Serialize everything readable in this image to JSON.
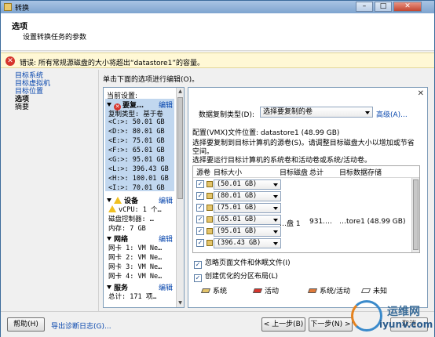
{
  "window": {
    "title": "转换"
  },
  "header": {
    "title": "选项",
    "subtitle": "设置转换任务的参数"
  },
  "error_bar": {
    "text": "错误: 所有常规源磁盘的大小将超出“datastore1”的容量。"
  },
  "nav": {
    "items": [
      {
        "label": "目标系统",
        "state": "link"
      },
      {
        "label": "目标虚拟机",
        "state": "link"
      },
      {
        "label": "目标位置",
        "state": "link"
      },
      {
        "label": "选项",
        "state": "current"
      },
      {
        "label": "摘要",
        "state": "plain"
      }
    ]
  },
  "instruction": "单击下面的选项进行编辑(O)。",
  "summary": {
    "header": "当前设置:",
    "copy_section": {
      "title": "要复…",
      "edit": "编辑"
    },
    "copy_type": "复制类型: 基于卷",
    "volumes": [
      "<C:>: 50.01 GB",
      "<D:>: 80.01 GB",
      "<E:>: 75.01 GB",
      "<F:>: 65.01 GB",
      "<G:>: 95.01 GB",
      "<L:>: 396.43 GB",
      "<H:>: 100.01 GB",
      "<I:>: 70.01 GB"
    ],
    "devices_section": {
      "title": "设备",
      "edit": "编辑"
    },
    "vcpu": "vCPU: 1 个…",
    "disk_ctrl": "磁盘控制器: …",
    "memory": "内存: 7 GB",
    "network_section": {
      "title": "网络",
      "edit": "编辑"
    },
    "nics": [
      "网卡 1: VM Ne…",
      "网卡 2: VM Ne…",
      "网卡 3: VM Ne…",
      "网卡 4: VM Ne…"
    ],
    "services_section": {
      "title": "服务",
      "edit": "编辑"
    },
    "services_total": "总计: 171 项…"
  },
  "options": {
    "close_glyph": "✕",
    "copy_type_label": "数据复制类型(D):",
    "copy_type_value": "选择要复制的卷",
    "advanced_link": "高级(A)...",
    "config_location": "配置(VMX)文件位置: datastore1 (48.99 GB)",
    "desc1": "选择要复制到目标计算机的源卷(S)。请调整目标磁盘大小以增加或节省",
    "desc2": "空间。",
    "desc3": "选择要运行目标计算机的系统卷和活动卷或系统/活动卷。",
    "table": {
      "headers": [
        "源卷",
        "目标大小",
        "目标磁盘",
        "总计",
        "目标数据存储"
      ],
      "rows": [
        {
          "checked": true,
          "size": "(50.01 GB)"
        },
        {
          "checked": true,
          "size": "(80.01 GB)"
        },
        {
          "checked": true,
          "size": "(75.01 GB)"
        },
        {
          "checked": true,
          "size": "(65.01 GB)"
        },
        {
          "checked": true,
          "size": "(95.01 GB)"
        },
        {
          "checked": true,
          "size": "(396.43 GB)"
        }
      ],
      "merged": {
        "disk": "…盘 1",
        "total": "931.…",
        "datastore": "…tore1 (48.99 GB)"
      }
    },
    "ignore_pagefile": {
      "label": "忽略页面文件和休眠文件(I)",
      "checked": true
    },
    "optimized_layout": {
      "label": "创建优化的分区布局(L)",
      "checked": true
    },
    "legend": [
      {
        "label": "系统",
        "color": "#e4c46a"
      },
      {
        "label": "活动",
        "color": "#d6352d"
      },
      {
        "label": "系统/活动",
        "color": "#e07a3a"
      },
      {
        "label": "未知",
        "color": "#ffffff"
      }
    ]
  },
  "footer": {
    "help": "帮助(H)",
    "export_logs": "导出诊断日志(G)...",
    "back": "< 上一步(B)",
    "next": "下一步(N) >",
    "cancel": "取消"
  },
  "watermark": {
    "line1": "运维网",
    "line2": "iyunv.com"
  }
}
